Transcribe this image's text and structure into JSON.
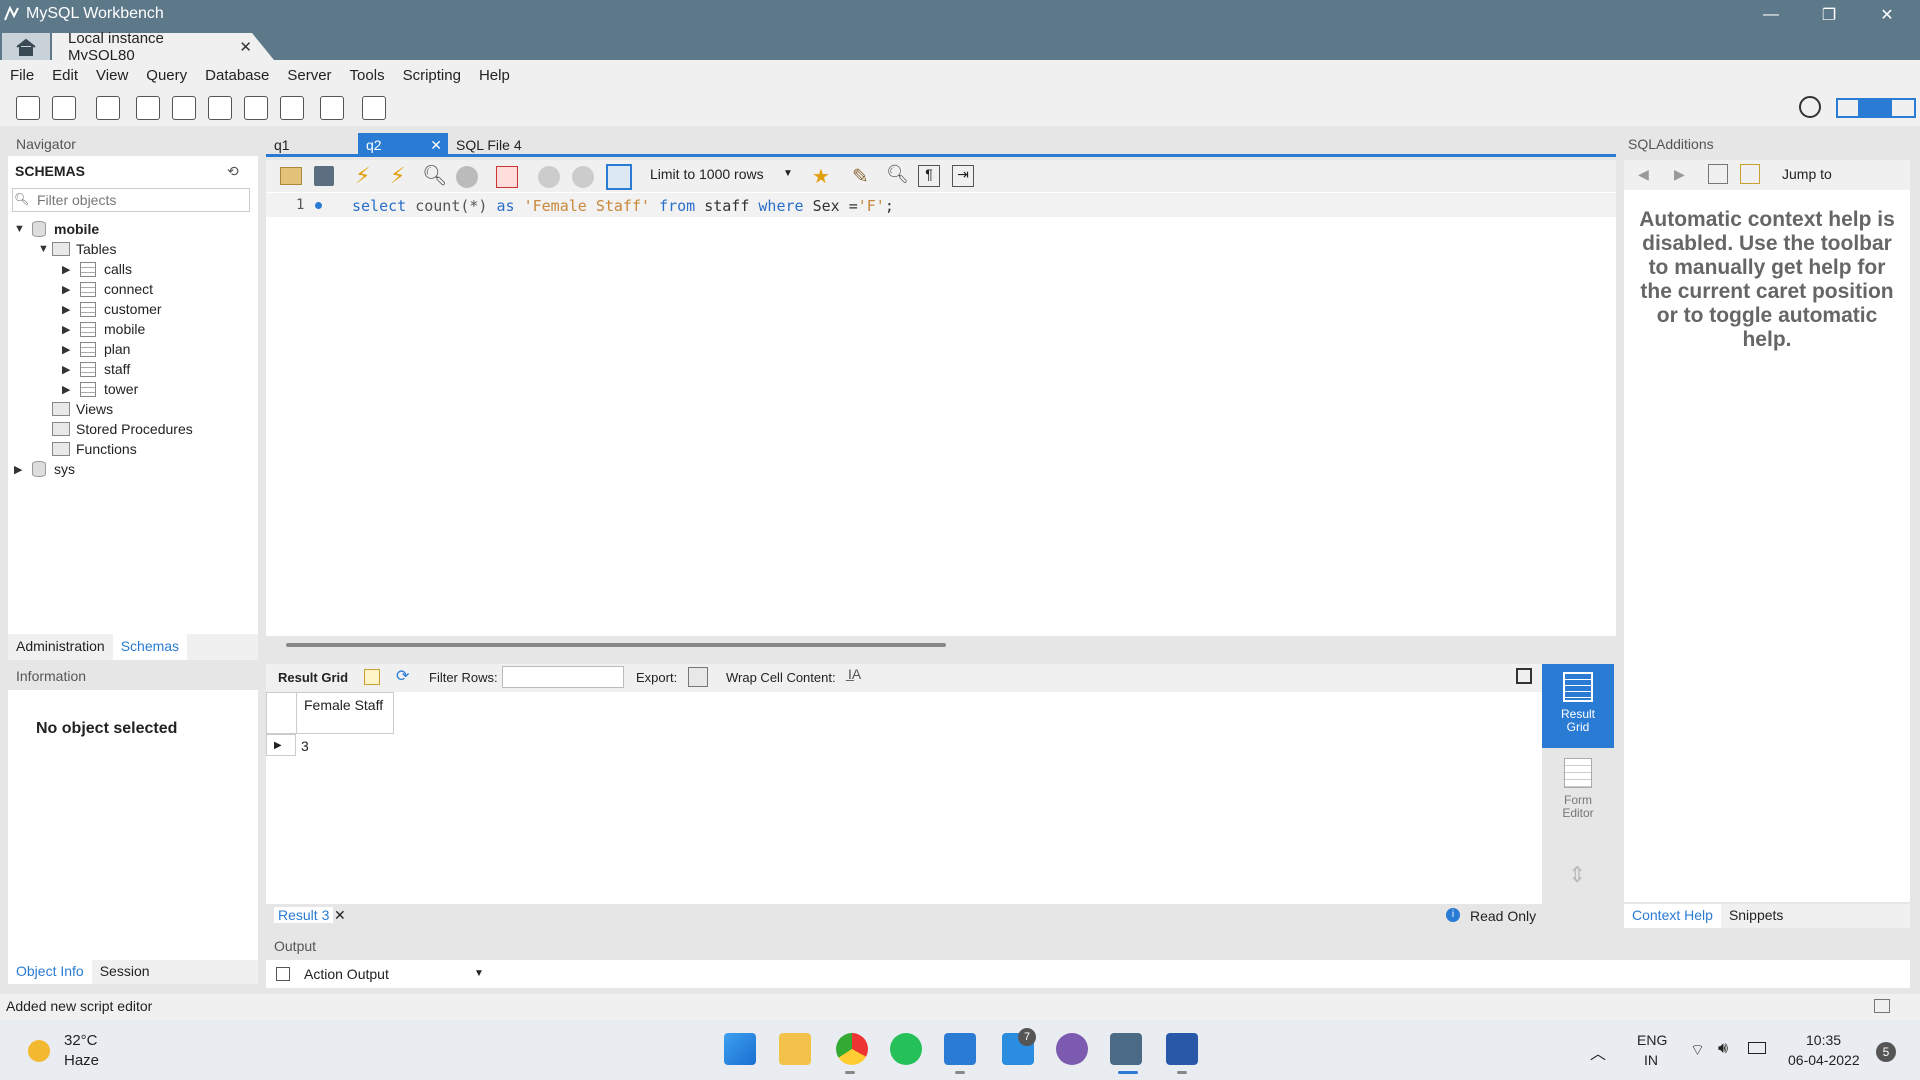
{
  "window": {
    "title": "MySQL Workbench",
    "connection_tab": "Local instance MySQL80",
    "minimize": "—",
    "maximize": "❐",
    "close": "✕"
  },
  "menu": [
    "File",
    "Edit",
    "View",
    "Query",
    "Database",
    "Server",
    "Tools",
    "Scripting",
    "Help"
  ],
  "navigator": {
    "header": "Navigator",
    "schemas_title": "SCHEMAS",
    "filter_placeholder": "Filter objects",
    "schema_mobile": "mobile",
    "tables_label": "Tables",
    "tables": [
      "calls",
      "connect",
      "customer",
      "mobile",
      "plan",
      "staff",
      "tower"
    ],
    "views_label": "Views",
    "stored_procedures_label": "Stored Procedures",
    "functions_label": "Functions",
    "schema_sys": "sys",
    "tabs": [
      "Administration",
      "Schemas"
    ]
  },
  "information": {
    "header": "Information",
    "no_object": "No object selected",
    "tabs": [
      "Object Info",
      "Session"
    ]
  },
  "editor": {
    "tabs": [
      "q1",
      "q2",
      "SQL File 4"
    ],
    "limit_label": "Limit to 1000 rows",
    "line_number": "1",
    "code": {
      "select": "select",
      "count": "count(*)",
      "as": "as",
      "alias": "'Female Staff'",
      "from": "from",
      "table": "staff",
      "where": "where",
      "column": "Sex =",
      "value": "'F'",
      "end": ";"
    }
  },
  "result": {
    "toolbar": {
      "result_grid": "Result Grid",
      "filter_rows": "Filter Rows:",
      "export": "Export:",
      "wrap": "Wrap Cell Content:"
    },
    "column_header": "Female Staff",
    "value": "3",
    "side": {
      "result_grid": "Result Grid",
      "form_editor": "Form Editor"
    },
    "bottom_tab": "Result 3",
    "read_only": "Read Only"
  },
  "output": {
    "header": "Output",
    "select": "Action Output"
  },
  "sql_additions": {
    "header": "SQLAdditions",
    "jump_to": "Jump to",
    "help_text": "Automatic context help is disabled. Use the toolbar to manually get help for the current caret position or to toggle automatic help.",
    "tabs": [
      "Context Help",
      "Snippets"
    ]
  },
  "status": "Added new script editor",
  "taskbar": {
    "temperature": "32°C",
    "weather": "Haze",
    "lang": "ENG",
    "region": "IN",
    "time": "10:35",
    "date": "06-04-2022",
    "notification_count": "5",
    "badge": "7"
  },
  "colors": {
    "title_bar": "#5d7889",
    "accent": "#2a7bd4"
  }
}
